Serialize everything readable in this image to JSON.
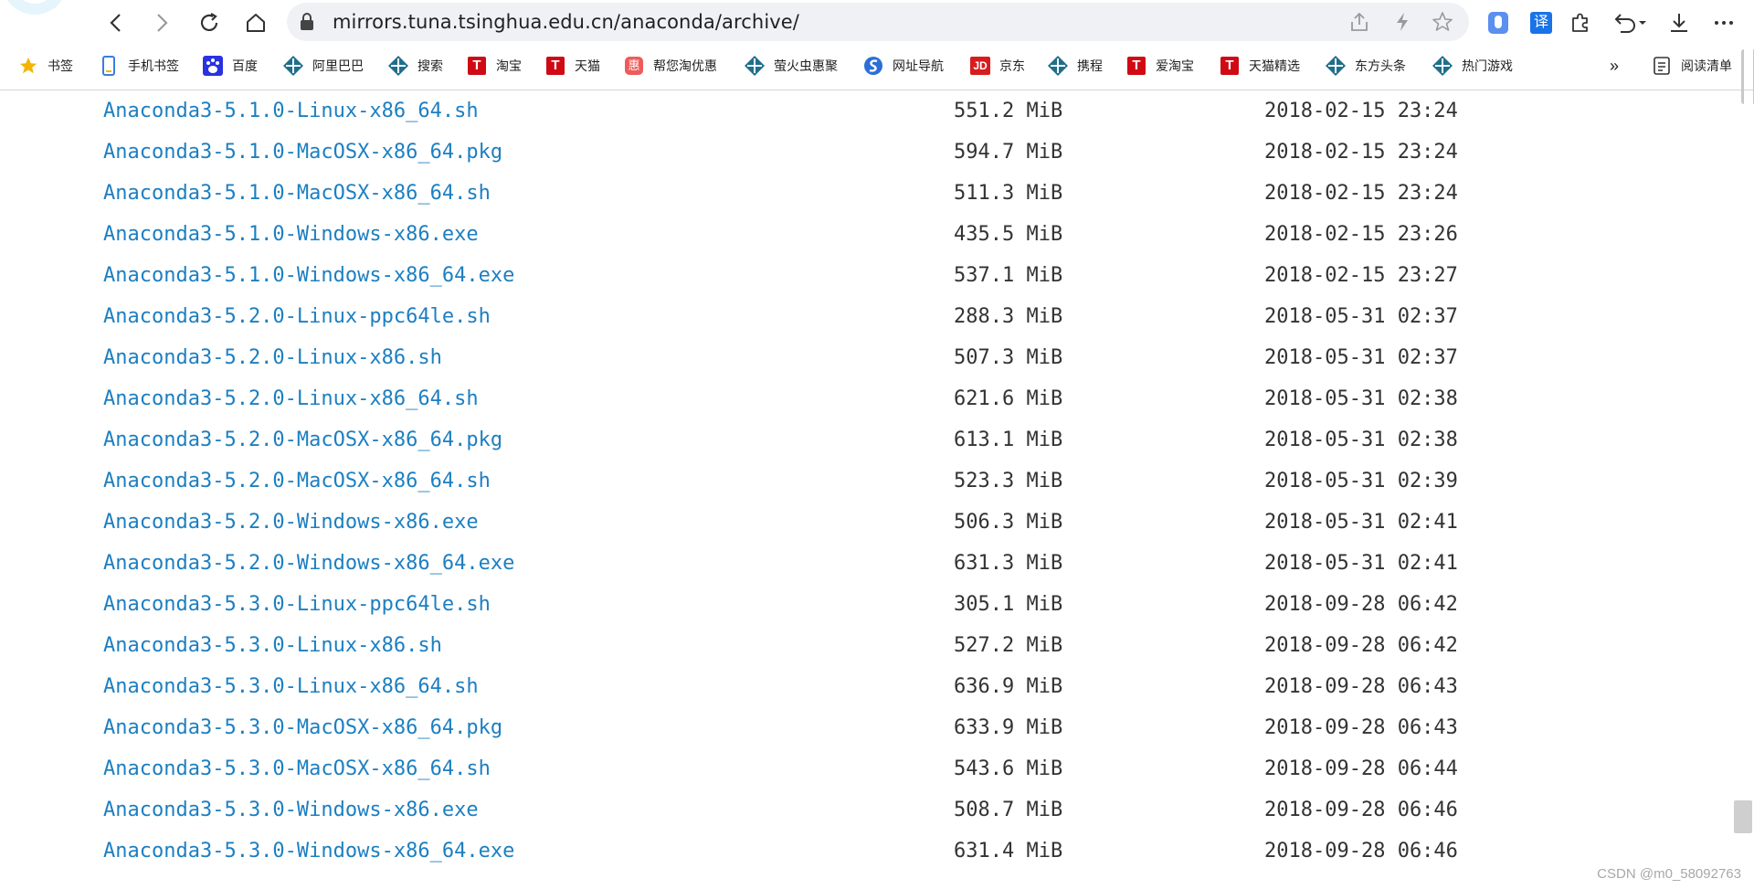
{
  "browser": {
    "url": "mirrors.tuna.tsinghua.edu.cn/anaconda/archive/",
    "more_bookmarks": "»",
    "reading_list_label": "阅读清单",
    "translate_label": "译"
  },
  "bookmarks": [
    {
      "label": "书签",
      "icon": "star-icon"
    },
    {
      "label": "手机书签",
      "icon": "phone-icon"
    },
    {
      "label": "百度",
      "icon": "baidu-paw-icon"
    },
    {
      "label": "阿里巴巴",
      "icon": "diamond-icon"
    },
    {
      "label": "搜索",
      "icon": "diamond-icon"
    },
    {
      "label": "淘宝",
      "icon": "t-icon",
      "glyph": "T"
    },
    {
      "label": "天猫",
      "icon": "t-icon",
      "glyph": "T"
    },
    {
      "label": "帮您淘优惠",
      "icon": "coupon-icon",
      "glyph": "惠"
    },
    {
      "label": "萤火虫惠聚",
      "icon": "diamond-icon"
    },
    {
      "label": "网址导航",
      "icon": "sogou-icon"
    },
    {
      "label": "京东",
      "icon": "jd-icon",
      "glyph": "JD"
    },
    {
      "label": "携程",
      "icon": "diamond-icon"
    },
    {
      "label": "爱淘宝",
      "icon": "t-icon",
      "glyph": "T"
    },
    {
      "label": "天猫精选",
      "icon": "t-icon",
      "glyph": "T"
    },
    {
      "label": "东方头条",
      "icon": "diamond-icon"
    },
    {
      "label": "热门游戏",
      "icon": "diamond-icon"
    }
  ],
  "files": [
    {
      "name": "Anaconda3-5.1.0-Linux-x86_64.sh",
      "size": "551.2 MiB",
      "date": "2018-02-15 23:24"
    },
    {
      "name": "Anaconda3-5.1.0-MacOSX-x86_64.pkg",
      "size": "594.7 MiB",
      "date": "2018-02-15 23:24"
    },
    {
      "name": "Anaconda3-5.1.0-MacOSX-x86_64.sh",
      "size": "511.3 MiB",
      "date": "2018-02-15 23:24"
    },
    {
      "name": "Anaconda3-5.1.0-Windows-x86.exe",
      "size": "435.5 MiB",
      "date": "2018-02-15 23:26"
    },
    {
      "name": "Anaconda3-5.1.0-Windows-x86_64.exe",
      "size": "537.1 MiB",
      "date": "2018-02-15 23:27"
    },
    {
      "name": "Anaconda3-5.2.0-Linux-ppc64le.sh",
      "size": "288.3 MiB",
      "date": "2018-05-31 02:37"
    },
    {
      "name": "Anaconda3-5.2.0-Linux-x86.sh",
      "size": "507.3 MiB",
      "date": "2018-05-31 02:37"
    },
    {
      "name": "Anaconda3-5.2.0-Linux-x86_64.sh",
      "size": "621.6 MiB",
      "date": "2018-05-31 02:38"
    },
    {
      "name": "Anaconda3-5.2.0-MacOSX-x86_64.pkg",
      "size": "613.1 MiB",
      "date": "2018-05-31 02:38"
    },
    {
      "name": "Anaconda3-5.2.0-MacOSX-x86_64.sh",
      "size": "523.3 MiB",
      "date": "2018-05-31 02:39"
    },
    {
      "name": "Anaconda3-5.2.0-Windows-x86.exe",
      "size": "506.3 MiB",
      "date": "2018-05-31 02:41"
    },
    {
      "name": "Anaconda3-5.2.0-Windows-x86_64.exe",
      "size": "631.3 MiB",
      "date": "2018-05-31 02:41"
    },
    {
      "name": "Anaconda3-5.3.0-Linux-ppc64le.sh",
      "size": "305.1 MiB",
      "date": "2018-09-28 06:42"
    },
    {
      "name": "Anaconda3-5.3.0-Linux-x86.sh",
      "size": "527.2 MiB",
      "date": "2018-09-28 06:42"
    },
    {
      "name": "Anaconda3-5.3.0-Linux-x86_64.sh",
      "size": "636.9 MiB",
      "date": "2018-09-28 06:43"
    },
    {
      "name": "Anaconda3-5.3.0-MacOSX-x86_64.pkg",
      "size": "633.9 MiB",
      "date": "2018-09-28 06:43"
    },
    {
      "name": "Anaconda3-5.3.0-MacOSX-x86_64.sh",
      "size": "543.6 MiB",
      "date": "2018-09-28 06:44"
    },
    {
      "name": "Anaconda3-5.3.0-Windows-x86.exe",
      "size": "508.7 MiB",
      "date": "2018-09-28 06:46"
    },
    {
      "name": "Anaconda3-5.3.0-Windows-x86_64.exe",
      "size": "631.4 MiB",
      "date": "2018-09-28 06:46"
    }
  ],
  "watermark": "CSDN @m0_58092763",
  "colors": {
    "link": "#1c7fc1",
    "text": "#333333",
    "taobao_red": "#cf0a15",
    "accent_blue": "#1a73e8"
  }
}
